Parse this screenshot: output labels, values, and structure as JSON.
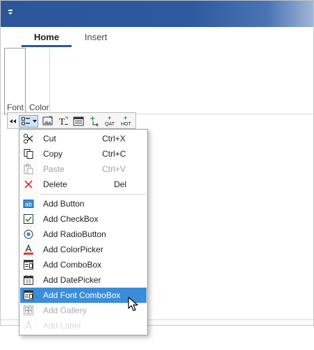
{
  "ribbon": {
    "tabs": [
      {
        "label": "Home",
        "selected": true
      },
      {
        "label": "Insert",
        "selected": false
      }
    ],
    "groups": [
      {
        "label": "Font"
      },
      {
        "label": "Color"
      }
    ]
  },
  "toolbar": {
    "qat_label": "QAT",
    "hot_label": "HOT",
    "icons": [
      "overflow-arrows-icon",
      "command-list-icon",
      "image-icon",
      "text-format-icon",
      "table-icon",
      "add-to-group-icon",
      "add-to-qat-icon",
      "add-to-hot-icon"
    ]
  },
  "menu": {
    "items": [
      {
        "label": "Cut",
        "shortcut": "Ctrl+X",
        "icon": "scissors-icon",
        "enabled": true
      },
      {
        "label": "Copy",
        "shortcut": "Ctrl+C",
        "icon": "copy-icon",
        "enabled": true
      },
      {
        "label": "Paste",
        "shortcut": "Ctrl+V",
        "icon": "paste-icon",
        "enabled": false
      },
      {
        "label": "Delete",
        "shortcut": "Del",
        "icon": "delete-x-icon",
        "enabled": true
      },
      {
        "label": "Add Button",
        "icon": "button-icon",
        "enabled": true
      },
      {
        "label": "Add CheckBox",
        "icon": "checkbox-icon",
        "enabled": true
      },
      {
        "label": "Add RadioButton",
        "icon": "radio-button-icon",
        "enabled": true
      },
      {
        "label": "Add ColorPicker",
        "icon": "color-picker-icon",
        "enabled": true
      },
      {
        "label": "Add ComboBox",
        "icon": "combobox-icon",
        "enabled": true
      },
      {
        "label": "Add DatePicker",
        "icon": "calendar-icon",
        "enabled": true
      },
      {
        "label": "Add Font ComboBox",
        "icon": "font-combobox-icon",
        "enabled": true,
        "selected": true
      },
      {
        "label": "Add Gallery",
        "icon": "gallery-icon",
        "enabled": false
      },
      {
        "label": "Add Label",
        "icon": "label-icon",
        "enabled": false
      }
    ]
  },
  "colors": {
    "titlebar": "#2b579a",
    "selection": "#3c8dd9",
    "delete_red": "#d13438",
    "accent_green": "#1f8b3a"
  }
}
